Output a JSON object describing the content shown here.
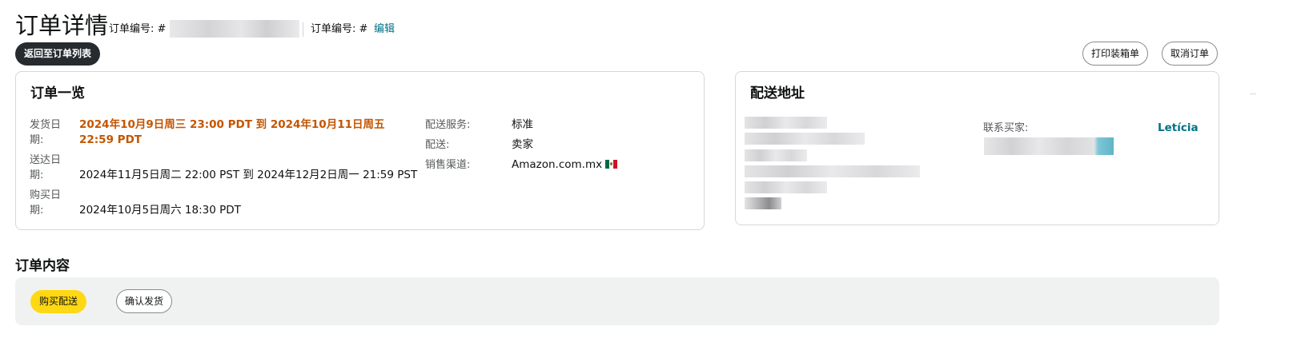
{
  "header": {
    "title": "订单详情",
    "order_number_label_1": "订单编号: #",
    "order_number_label_2": "订单编号: #",
    "edit_link": "编辑"
  },
  "actions": {
    "back_button": "返回至订单列表",
    "print_packing_slip": "打印装箱单",
    "cancel_order": "取消订单"
  },
  "order_overview": {
    "title": "订单一览",
    "ship_date_label": "发货日期:",
    "ship_date_value": "2024年10月9日周三 23:00 PDT 到 2024年10月11日周五 22:59 PDT",
    "delivery_date_label": "送达日期:",
    "delivery_date_value": "2024年11月5日周二 22:00 PST 到 2024年12月2日周一 21:59 PST",
    "purchase_date_label": "购买日期:",
    "purchase_date_value": "2024年10月5日周六 18:30 PDT",
    "shipping_service_label": "配送服务:",
    "shipping_service_value": "标准",
    "fulfillment_label": "配送:",
    "fulfillment_value": "卖家",
    "sales_channel_label": "销售渠道:",
    "sales_channel_value": "Amazon.com.mx",
    "flag_icon": "mexico-flag-icon"
  },
  "shipping_address": {
    "title": "配送地址",
    "contact_buyer_label": "联系买家:",
    "buyer_name": "Letícia"
  },
  "order_contents": {
    "title": "订单内容",
    "buy_shipping_button": "购买配送",
    "confirm_shipment_button": "确认发货"
  },
  "colors": {
    "accent_orange": "#c45500",
    "link_teal": "#007185",
    "button_yellow": "#ffd814",
    "button_dark": "#262b2f"
  }
}
